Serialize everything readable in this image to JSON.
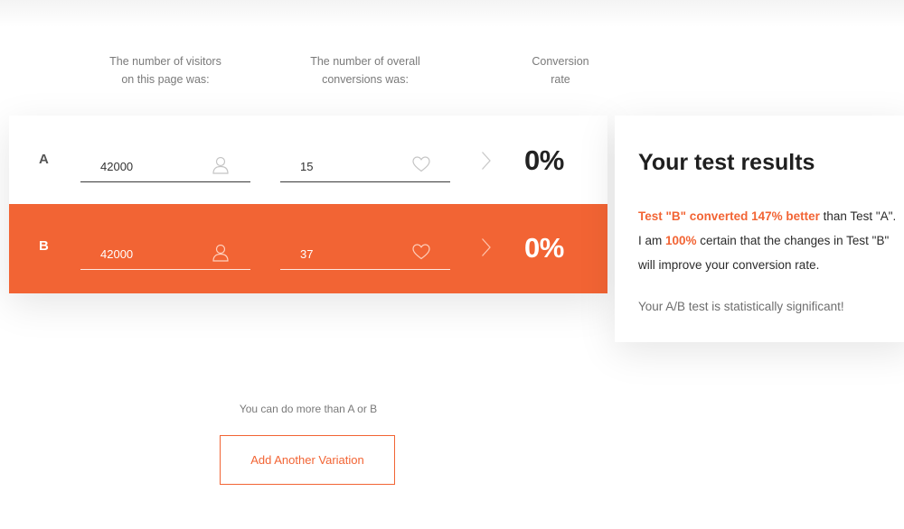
{
  "headers": {
    "visitors": "The number of visitors\non this page was:",
    "conversions": "The number of overall\nconversions was:",
    "rate": "Conversion\nrate"
  },
  "rows": [
    {
      "label": "A",
      "visitors": "42000",
      "conversions": "15",
      "rate": "0%"
    },
    {
      "label": "B",
      "visitors": "42000",
      "conversions": "37",
      "rate": "0%"
    }
  ],
  "results": {
    "title": "Your test results",
    "line1_highlight": "Test \"B\" converted 147% better",
    "line1_rest": " than Test \"A\".",
    "line2_prefix": "I am ",
    "line2_highlight": "100%",
    "line2_rest": " certain that the changes in Test \"B\"",
    "line3": "will improve your conversion rate.",
    "significance": "Your A/B test is statistically significant!"
  },
  "more": {
    "text": "You can do more than A or B",
    "button_label": "Add Another Variation"
  },
  "icons": {
    "visitors": "user-icon",
    "conversions": "heart-icon",
    "arrow": "chevron-right-icon"
  },
  "colors": {
    "accent": "#f26434",
    "row_a_bg": "#ffffff",
    "row_b_bg": "#f26434",
    "text_dark": "#222222",
    "text_muted": "#7a7a7a"
  }
}
